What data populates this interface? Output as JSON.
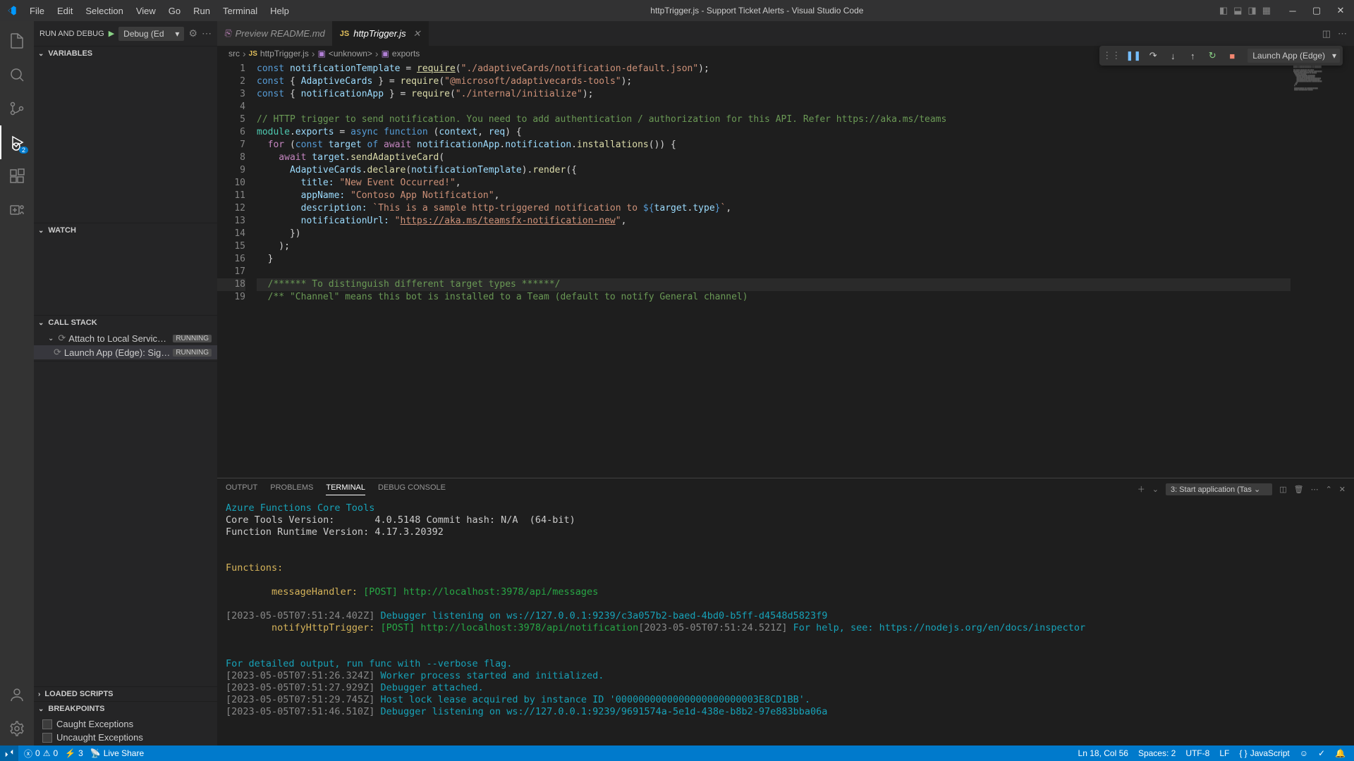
{
  "title": "httpTrigger.js - Support Ticket Alerts - Visual Studio Code",
  "menus": [
    "File",
    "Edit",
    "Selection",
    "View",
    "Go",
    "Run",
    "Terminal",
    "Help"
  ],
  "runAndDebug": {
    "label": "RUN AND DEBUG",
    "config": "Debug (Ed"
  },
  "sidebarSections": {
    "variables": "VARIABLES",
    "watch": "WATCH",
    "callStack": "CALL STACK",
    "loadedScripts": "LOADED SCRIPTS",
    "breakpoints": "BREAKPOINTS"
  },
  "callStack": [
    {
      "label": "Attach to Local Service: Re...",
      "status": "RUNNING",
      "selected": false
    },
    {
      "label": "Launch App (Edge): Sign in ...",
      "status": "RUNNING",
      "selected": true
    }
  ],
  "breakpoints": [
    "Caught Exceptions",
    "Uncaught Exceptions"
  ],
  "tabs": [
    {
      "label": "Preview README.md",
      "active": false,
      "icon": "preview"
    },
    {
      "label": "httpTrigger.js",
      "active": true,
      "icon": "js"
    }
  ],
  "debugLaunch": "Launch App (Edge)",
  "breadcrumb": {
    "folder": "src",
    "file": "httpTrigger.js",
    "unknown": "<unknown>",
    "symbol": "exports"
  },
  "gutterStart": 1,
  "gutterEnd": 19,
  "currentLine": 18,
  "code": {
    "l1": {
      "kw": "const",
      "var": "notificationTemplate",
      "eq": " = ",
      "fn": "require",
      "paren": "(",
      "str": "\"./adaptiveCards/notification-default.json\"",
      "close": ");"
    },
    "l2a": "const ",
    "l2b": "{ AdaptiveCards }",
    "l2c": " = ",
    "l2fn": "require",
    "l2s": "\"@microsoft/adaptivecards-tools\"",
    "l2e": ");",
    "l3a": "const ",
    "l3b": "{ notificationApp }",
    "l3c": " = ",
    "l3fn": "require",
    "l3s": "\"./internal/initialize\"",
    "l3e": ");",
    "l5": "// HTTP trigger to send notification. You need to add authentication / authorization for this API. Refer https://aka.ms/teams",
    "l6a": "module",
    "l6b": ".",
    "l6c": "exports",
    "l6d": " = ",
    "l6e": "async function ",
    "l6f": "(context, req)",
    "l6g": " {",
    "l7a": "  for ",
    "l7b": "(",
    "l7c": "const ",
    "l7d": "target",
    "l7e": " of ",
    "l7f": "await ",
    "l7g": "notificationApp",
    "l7h": ".",
    "l7i": "notification",
    "l7j": ".",
    "l7k": "installations",
    "l7l": "()) {",
    "l8a": "    await ",
    "l8b": "target",
    "l8c": ".",
    "l8d": "sendAdaptiveCard",
    "l8e": "(",
    "l9a": "      ",
    "l9b": "AdaptiveCards",
    "l9c": ".",
    "l9d": "declare",
    "l9e": "(",
    "l9f": "notificationTemplate",
    "l9g": ").",
    "l9h": "render",
    "l9i": "({",
    "l10a": "        ",
    "l10b": "title:",
    "l10c": " \"New Event Occurred!\"",
    "l10d": ",",
    "l11a": "        ",
    "l11b": "appName:",
    "l11c": " \"Contoso App Notification\"",
    "l11d": ",",
    "l12a": "        ",
    "l12b": "description:",
    "l12c": " `This is a sample http-triggered notification to ",
    "l12d": "${",
    "l12e": "target",
    "l12f": ".",
    "l12g": "type",
    "l12h": "}",
    "l12i": "`",
    "l12j": ",",
    "l13a": "        ",
    "l13b": "notificationUrl:",
    "l13c": " \"",
    "l13d": "https://aka.ms/teamsfx-notification-new",
    "l13e": "\"",
    "l13f": ",",
    "l14": "      })",
    "l15": "    );",
    "l16": "  }",
    "l18": "  /****** To distinguish different target types ******/",
    "l19": "  /** \"Channel\" means this bot is installed to a Team (default to notify General channel)"
  },
  "panelTabs": [
    "OUTPUT",
    "PROBLEMS",
    "TERMINAL",
    "DEBUG CONSOLE"
  ],
  "panelActiveTab": "TERMINAL",
  "taskSelect": "3: Start application (Tas",
  "terminal": {
    "t1": "Azure Functions Core Tools",
    "t2": "Core Tools Version:       4.0.5148 Commit hash: N/A  (64-bit)",
    "t3": "Function Runtime Version: 4.17.3.20392",
    "t4": "Functions:",
    "t5a": "        messageHandler:",
    "t5b": " [POST] http://localhost:3978/api/messages",
    "t6a": "[2023-05-05T07:51:24.402Z] ",
    "t6b": "Debugger listening on ws://127.0.0.1:9239/c3a057b2-baed-4bd0-b5ff-d4548d5823f9",
    "t7a": "        notifyHttpTrigger:",
    "t7b": " [POST] http://localhost:3978/api/notification",
    "t7c": "[2023-05-05T07:51:24.521Z] ",
    "t7d": "For help, see: https://nodejs.org/en/docs/inspector",
    "t9": "For detailed output, run func with --verbose flag.",
    "t10a": "[2023-05-05T07:51:26.324Z] ",
    "t10b": "Worker process started and initialized.",
    "t11a": "[2023-05-05T07:51:27.929Z] ",
    "t11b": "Debugger attached.",
    "t12a": "[2023-05-05T07:51:29.745Z] ",
    "t12b": "Host lock lease acquired by instance ID '0000000000000000000000003E8CD1BB'.",
    "t13a": "[2023-05-05T07:51:46.510Z] ",
    "t13b": "Debugger listening on ws://127.0.0.1:9239/9691574a-5e1d-438e-b8b2-97e883bba06a"
  },
  "status": {
    "errors": "0",
    "warnings": "0",
    "ports": "3",
    "liveShare": "Live Share",
    "lnCol": "Ln 18, Col 56",
    "spaces": "Spaces: 2",
    "encoding": "UTF-8",
    "eol": "LF",
    "lang": "JavaScript"
  },
  "activityBadge": "2"
}
